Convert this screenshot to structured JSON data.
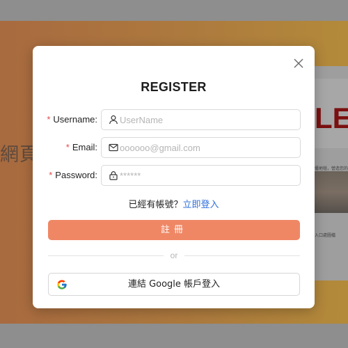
{
  "background": {
    "left_text": "網頁",
    "panel_title": "LE",
    "panel_caption_1": "優地毯，營造您的家",
    "panel_caption_2": "入口處圖檔"
  },
  "modal": {
    "title": "REGISTER",
    "close_icon": "close-icon",
    "required_mark": "*",
    "fields": {
      "username": {
        "label": "Username",
        "colon": ":",
        "placeholder": "UserName",
        "value": "",
        "icon": "user-icon"
      },
      "email": {
        "label": "Email",
        "colon": ":",
        "placeholder": "oooooo@gmail.com",
        "value": "",
        "icon": "mail-icon"
      },
      "password": {
        "label": "Password",
        "colon": ":",
        "placeholder": "******",
        "value": "",
        "icon": "lock-icon"
      }
    },
    "login_prompt": "已經有帳號？",
    "login_link": "立即登入",
    "register_button": "註冊",
    "divider_text": "or",
    "google_button": "連結 Google 帳戶登入",
    "google_icon": "google-icon"
  },
  "colors": {
    "accent": "#ef8765",
    "link": "#2f6fdc",
    "required": "#e14b4b"
  }
}
